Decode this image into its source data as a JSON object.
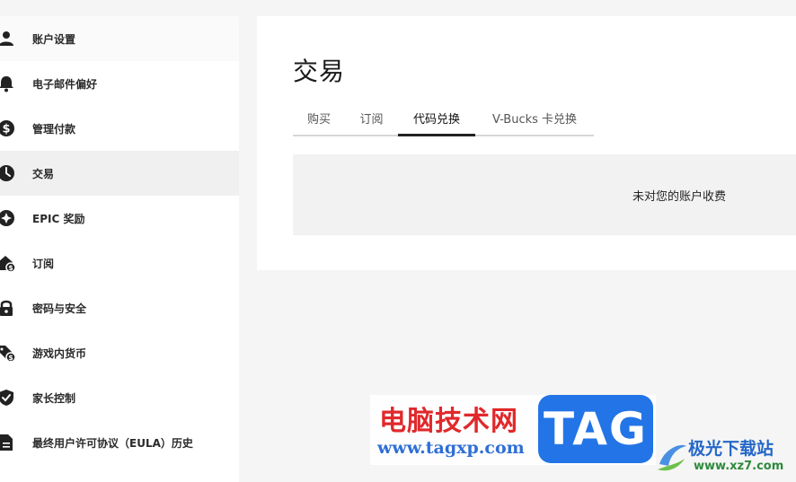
{
  "sidebar": {
    "items": [
      {
        "label": "账户设置",
        "icon": "person-icon"
      },
      {
        "label": "电子邮件偏好",
        "icon": "bell-icon"
      },
      {
        "label": "管理付款",
        "icon": "dollar-circle-icon"
      },
      {
        "label": "交易",
        "icon": "clock-icon"
      },
      {
        "label": "EPIC 奖励",
        "icon": "star-badge-icon"
      },
      {
        "label": "订阅",
        "icon": "house-dollar-icon"
      },
      {
        "label": "密码与安全",
        "icon": "lock-icon"
      },
      {
        "label": "游戏内货币",
        "icon": "tag-dollar-icon"
      },
      {
        "label": "家长控制",
        "icon": "shield-check-icon"
      },
      {
        "label": "最终用户许可协议（EULA）历史",
        "icon": "document-icon"
      }
    ],
    "active_index": 3
  },
  "main": {
    "title": "交易",
    "tabs": [
      {
        "label": "购买"
      },
      {
        "label": "订阅"
      },
      {
        "label": "代码兑换"
      },
      {
        "label": "V-Bucks 卡兑换"
      }
    ],
    "active_tab_index": 2,
    "empty_message": "未对您的账户收费"
  },
  "watermark": {
    "site_name": "电脑技术网",
    "site_url": "www.tagxp.com",
    "badge_text": "TAG"
  },
  "corner_logo": {
    "name": "极光下载站",
    "url": "www.xz7.com"
  },
  "colors": {
    "watermark_red": "#e0292c",
    "watermark_blue": "#2374e6",
    "logo_blue": "#2468c8",
    "logo_green": "#2f8a3d"
  }
}
